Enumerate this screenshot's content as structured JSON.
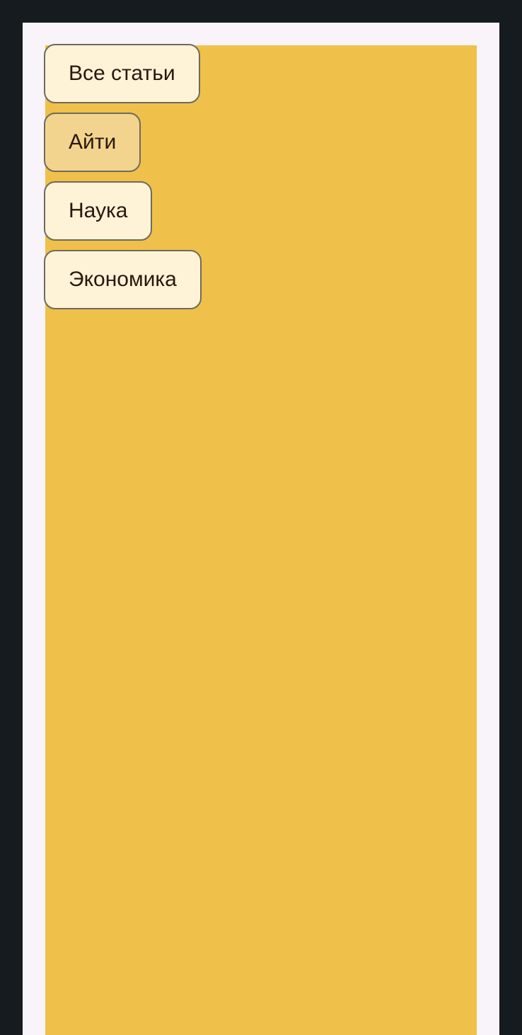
{
  "categories": {
    "items": [
      {
        "label": "Все статьи",
        "active": false
      },
      {
        "label": "Айти",
        "active": true
      },
      {
        "label": "Наука",
        "active": false
      },
      {
        "label": "Экономика",
        "active": false
      }
    ]
  },
  "colors": {
    "page_background": "#151b1f",
    "frame_background": "#f9f4fa",
    "panel_background": "#efc04a",
    "button_background": "#fef3d7",
    "button_active_background": "#f2d48e",
    "button_border": "#6f6a61",
    "button_text": "#2a170f"
  }
}
